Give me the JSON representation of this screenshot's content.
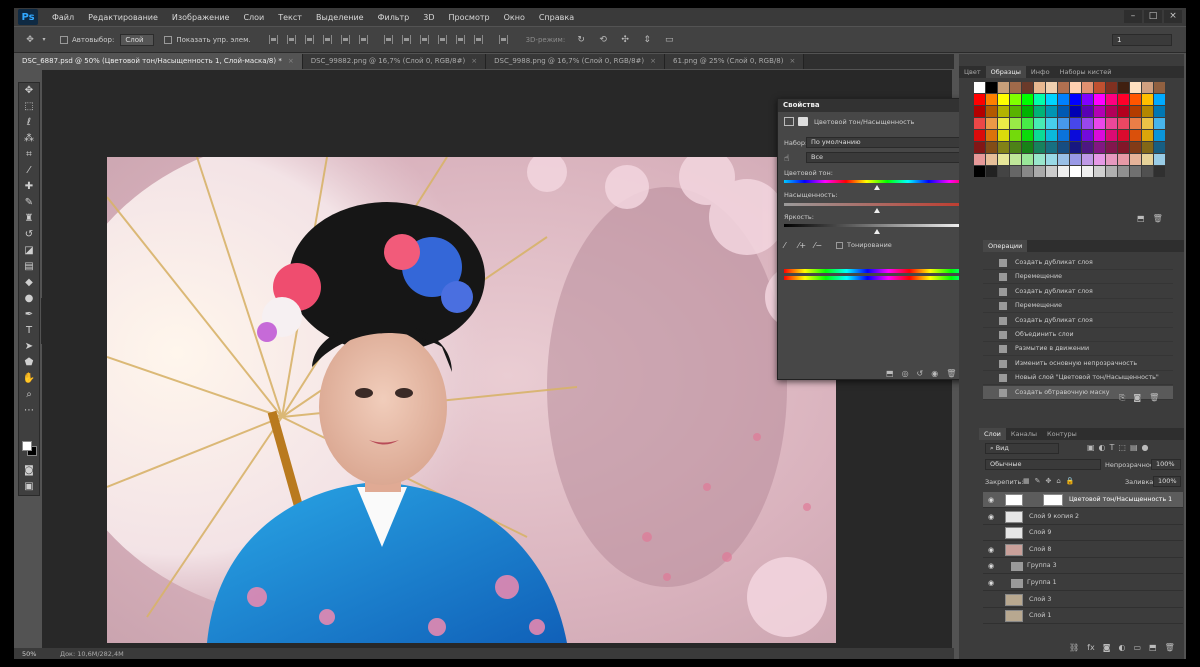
{
  "app": {
    "logo": "Ps"
  },
  "menu": [
    "Файл",
    "Редактирование",
    "Изображение",
    "Слои",
    "Текст",
    "Выделение",
    "Фильтр",
    "3D",
    "Просмотр",
    "Окно",
    "Справка"
  ],
  "options": {
    "autoselect_label": "Автовыбор:",
    "autoselect_value": "Слой",
    "show_controls_label": "Показать упр. элем.",
    "mode_3d": "3D-режим:",
    "right_field": "1"
  },
  "tabs": [
    "DSC_6887.psd @ 50% (Цветовой тон/Насыщенность 1, Слой-маска/8) *",
    "DSC_99882.png @ 16,7% (Слой 0, RGB/8#)",
    "DSC_9988.png @ 16,7% (Слой 0, RGB/8#)",
    "61.png @ 25% (Слой 0, RGB/8)"
  ],
  "status": {
    "zoom": "50%",
    "doc": "Док: 10,6M/282,4M"
  },
  "properties": {
    "panel_title": "Свойства",
    "adjustment_name": "Цветовой тон/Насыщенность",
    "preset_label": "Набор:",
    "preset_value": "По умолчанию",
    "channel_value": "Все",
    "hue_label": "Цветовой тон:",
    "hue_value": "0",
    "saturation_label": "Насыщенность:",
    "saturation_value": "0",
    "lightness_label": "Яркость:",
    "lightness_value": "0",
    "colorize_label": "Тонирование"
  },
  "swatches_panel": {
    "tabs": [
      "Цвет",
      "Образцы",
      "Инфо",
      "Наборы кистей"
    ],
    "active": 1
  },
  "history_panel": {
    "tabs": [
      "Операции"
    ],
    "items": [
      "Создать дубликат слоя",
      "Перемещение",
      "Создать дубликат слоя",
      "Перемещение",
      "Создать дубликат слоя",
      "Объединить слои",
      "Размытие в движении",
      "Изменить основную непрозрачность",
      "Новый слой \"Цветовой тон/Насыщенность\"",
      "Создать обтравочную маску"
    ]
  },
  "layers_panel": {
    "tabs": [
      "Слои",
      "Каналы",
      "Контуры"
    ],
    "filter_value": "Вид",
    "blend_mode": "Обычные",
    "opacity_label": "Непрозрачность:",
    "opacity_value": "100%",
    "lock_label": "Закрепить:",
    "fill_label": "Заливка:",
    "fill_value": "100%",
    "layers": [
      {
        "name": "Цветовой тон/Насыщенность 1",
        "visible": true,
        "active": true
      },
      {
        "name": "Слой 9 копия 2",
        "visible": true,
        "active": false
      },
      {
        "name": "Слой 9",
        "visible": false,
        "active": false
      },
      {
        "name": "Слой 8",
        "visible": true,
        "active": false
      },
      {
        "name": "Группа 3",
        "visible": true,
        "active": false
      },
      {
        "name": "Группа 1",
        "visible": true,
        "active": false
      },
      {
        "name": "Слой 3",
        "visible": false,
        "active": false
      },
      {
        "name": "Слой 1",
        "visible": false,
        "active": false
      }
    ]
  }
}
